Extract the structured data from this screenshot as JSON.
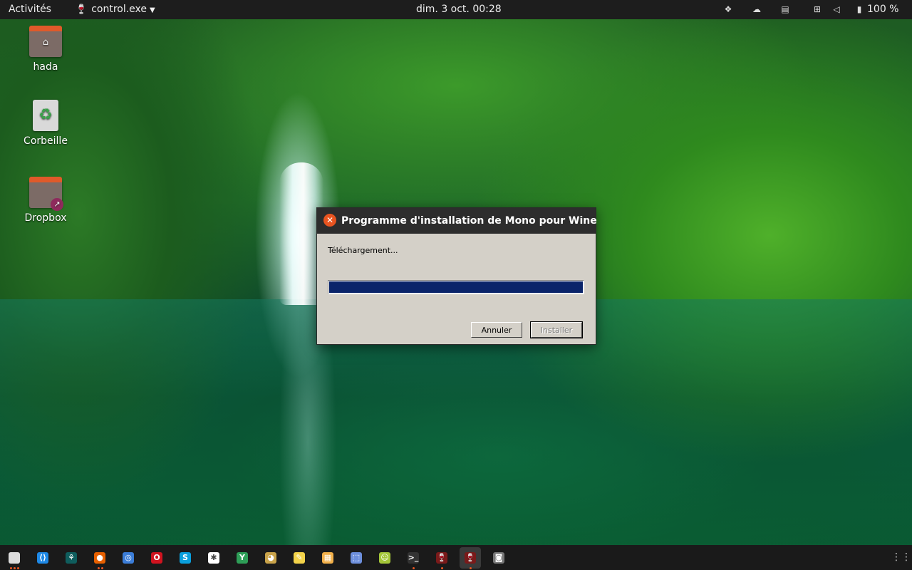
{
  "topbar": {
    "activities": "Activités",
    "app_menu": "control.exe",
    "clock": "dim. 3 oct.  00:28",
    "battery": "100 %",
    "tray_icons": [
      "dropbox-icon",
      "weather-icon",
      "clipboard-icon",
      "network-icon",
      "volume-icon",
      "battery-icon"
    ]
  },
  "desktop": {
    "icons": [
      {
        "label": "hada",
        "icon": "home-folder-icon"
      },
      {
        "label": "Corbeille",
        "icon": "trash-icon"
      },
      {
        "label": "Dropbox",
        "icon": "dropbox-folder-icon"
      }
    ]
  },
  "dialog": {
    "title": "Programme d'installation de Mono pour Wine",
    "status": "Téléchargement...",
    "progress": 1.0,
    "cancel_label": "Annuler",
    "install_label": "Installer"
  },
  "dock": {
    "items": [
      {
        "name": "files-icon",
        "color": "#dcdcdc",
        "glyph": "",
        "dots": 3
      },
      {
        "name": "vscode-icon",
        "color": "#1e88e5",
        "glyph": "⟨⟩",
        "dots": 0
      },
      {
        "name": "gitkraken-icon",
        "color": "#0f5d5d",
        "glyph": "⚘",
        "dots": 0
      },
      {
        "name": "firefox-icon",
        "color": "#e66000",
        "glyph": "●",
        "dots": 2
      },
      {
        "name": "chromium-icon",
        "color": "#3b7dd8",
        "glyph": "◎",
        "dots": 0
      },
      {
        "name": "opera-icon",
        "color": "#d0131f",
        "glyph": "O",
        "dots": 0
      },
      {
        "name": "skype-icon",
        "color": "#0a9fdc",
        "glyph": "S",
        "dots": 0
      },
      {
        "name": "slack-icon",
        "color": "#ffffff",
        "glyph": "✱",
        "dots": 0
      },
      {
        "name": "yakyak-icon",
        "color": "#2e9e57",
        "glyph": "Y",
        "dots": 0
      },
      {
        "name": "gimp-icon",
        "color": "#c9a34a",
        "glyph": "◕",
        "dots": 0
      },
      {
        "name": "notes-icon",
        "color": "#f3d34a",
        "glyph": "✎",
        "dots": 0
      },
      {
        "name": "calculator-icon",
        "color": "#f2b04a",
        "glyph": "▦",
        "dots": 0
      },
      {
        "name": "screenshot-icon",
        "color": "#6d8fdc",
        "glyph": "⬚",
        "dots": 0
      },
      {
        "name": "android-icon",
        "color": "#a4c639",
        "glyph": "☺",
        "dots": 0
      },
      {
        "name": "terminal-icon",
        "color": "#333333",
        "glyph": ">_",
        "dots": 1
      },
      {
        "name": "wine-icon",
        "color": "#7a1a1a",
        "glyph": "🍷",
        "dots": 1
      },
      {
        "name": "wine-installer-icon",
        "color": "#7a1a1a",
        "glyph": "🍷",
        "dots": 1,
        "active": true
      },
      {
        "name": "settings-icon",
        "color": "#777777",
        "glyph": "◙",
        "dots": 0
      }
    ]
  }
}
